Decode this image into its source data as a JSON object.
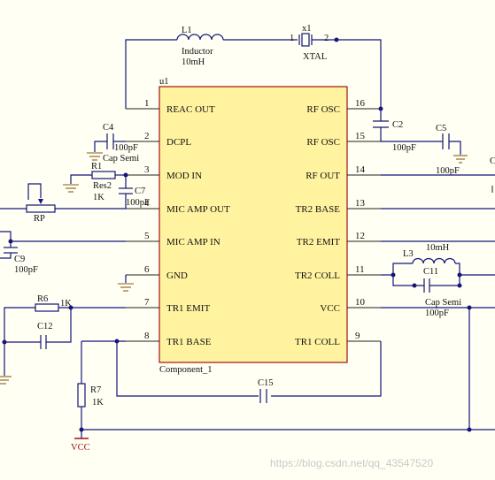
{
  "component": {
    "designator": "u1",
    "name": "Component_1",
    "left_pins": [
      {
        "num": "1",
        "label": "REAC OUT"
      },
      {
        "num": "2",
        "label": "DCPL"
      },
      {
        "num": "3",
        "label": "MOD IN"
      },
      {
        "num": "4",
        "label": "MIC AMP OUT"
      },
      {
        "num": "5",
        "label": "MIC AMP IN"
      },
      {
        "num": "6",
        "label": "GND"
      },
      {
        "num": "7",
        "label": "TR1 EMIT"
      },
      {
        "num": "8",
        "label": "TR1 BASE"
      }
    ],
    "right_pins": [
      {
        "num": "16",
        "label": "RF OSC"
      },
      {
        "num": "15",
        "label": "RF OSC"
      },
      {
        "num": "14",
        "label": "RF OUT"
      },
      {
        "num": "13",
        "label": "TR2 BASE"
      },
      {
        "num": "12",
        "label": "TR2 EMIT"
      },
      {
        "num": "11",
        "label": "TR2 COLL"
      },
      {
        "num": "10",
        "label": "VCC"
      },
      {
        "num": "9",
        "label": "TR1 COLL"
      }
    ]
  },
  "parts": {
    "L1": {
      "ref": "L1",
      "type": "Inductor",
      "value": "10mH"
    },
    "X1": {
      "ref": "x1",
      "type": "XTAL",
      "pin1": "1",
      "pin2": "2"
    },
    "C2": {
      "ref": "C2",
      "value": "100pF"
    },
    "C5": {
      "ref": "C5",
      "value": "100pF"
    },
    "C4": {
      "ref": "C4",
      "value": "100pF",
      "type": "Cap Semi"
    },
    "R1": {
      "ref": "R1",
      "type": "Res2",
      "value": "1K"
    },
    "C7": {
      "ref": "C7",
      "value": "100pF"
    },
    "RP": {
      "ref": "RP"
    },
    "C9": {
      "ref": "C9",
      "value": "100pF"
    },
    "L3": {
      "ref": "L3",
      "value": "10mH"
    },
    "C11": {
      "ref": "C11",
      "type": "Cap Semi",
      "value": "100pF"
    },
    "R6": {
      "ref": "R6",
      "value": "1K"
    },
    "C12": {
      "ref": "C12"
    },
    "C15": {
      "ref": "C15"
    },
    "R7": {
      "ref": "R7",
      "value": "1K"
    },
    "VCC": {
      "label": "VCC"
    },
    "edge_C": {
      "label": "C"
    }
  },
  "watermark": "https://blog.csdn.net/qq_43547520",
  "colors": {
    "background": "#fffff4",
    "body": "#fff3a0",
    "body_border": "#a01010",
    "wire": "#15157a",
    "ground": "#8a5a1a",
    "vcc": "#a01010"
  }
}
